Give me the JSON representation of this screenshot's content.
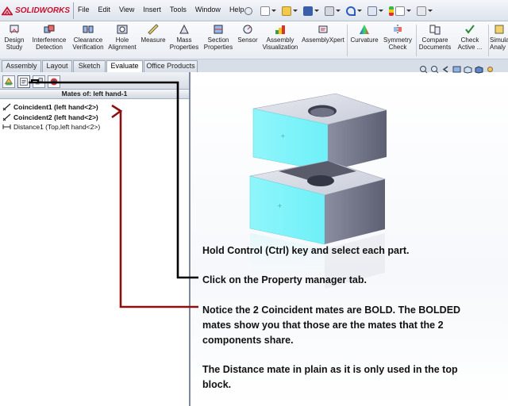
{
  "app": {
    "name": "SOLIDWORKS",
    "menus": [
      "File",
      "Edit",
      "View",
      "Insert",
      "Tools",
      "Window",
      "Help"
    ]
  },
  "ribbon": {
    "buttons": [
      {
        "label": "Design\nStudy",
        "icon": "design-study-icon"
      },
      {
        "label": "Interference\nDetection",
        "icon": "interference-detection-icon"
      },
      {
        "label": "Clearance\nVerification",
        "icon": "clearance-verification-icon"
      },
      {
        "label": "Hole\nAlignment",
        "icon": "hole-alignment-icon"
      },
      {
        "label": "Measure",
        "icon": "measure-icon"
      },
      {
        "label": "Mass\nProperties",
        "icon": "mass-properties-icon"
      },
      {
        "label": "Section\nProperties",
        "icon": "section-properties-icon"
      },
      {
        "label": "Sensor",
        "icon": "sensor-icon"
      },
      {
        "label": "Assembly\nVisualization",
        "icon": "assembly-visualization-icon"
      },
      {
        "label": "AssemblyXpert",
        "icon": "assemblyxpert-icon"
      },
      {
        "label": "Curvature",
        "icon": "curvature-icon"
      },
      {
        "label": "Symmetry\nCheck",
        "icon": "symmetry-check-icon"
      },
      {
        "label": "Compare\nDocuments",
        "icon": "compare-documents-icon"
      },
      {
        "label": "Check\nActive ...",
        "icon": "check-active-icon"
      },
      {
        "label": "Simula\nAnaly",
        "icon": "simulation-icon"
      }
    ]
  },
  "command_tabs": [
    "Assembly",
    "Layout",
    "Sketch",
    "Evaluate",
    "Office Products"
  ],
  "active_tab": "Evaluate",
  "panel": {
    "header": "Mates of: left hand-1",
    "mates": [
      {
        "label": "Coincident1 (left hand<2>)",
        "bold": true,
        "icon": "coincident-mate-icon"
      },
      {
        "label": "Coincident2 (left hand<2>)",
        "bold": true,
        "icon": "coincident-mate-icon"
      },
      {
        "label": "Distance1 (Top,left hand<2>)",
        "bold": false,
        "icon": "distance-mate-icon"
      }
    ]
  },
  "notes": {
    "note1": "Hold Control (Ctrl) key and select each part.",
    "note2": "Click on the Property manager tab.",
    "note3_line1": "Notice the 2 Coincident mates are BOLD.  The BOLDED",
    "note3_line2": "mates show you that those are the mates that the 2",
    "note3_line3": "components share.",
    "note4_line1": "The Distance mate in plain as it is only used in the top",
    "note4_line2": "block."
  },
  "colors": {
    "brand_red": "#c8102e",
    "selection_cyan": "#7ff4fb",
    "annotation_black": "#000000",
    "annotation_darkred": "#8b1010"
  }
}
